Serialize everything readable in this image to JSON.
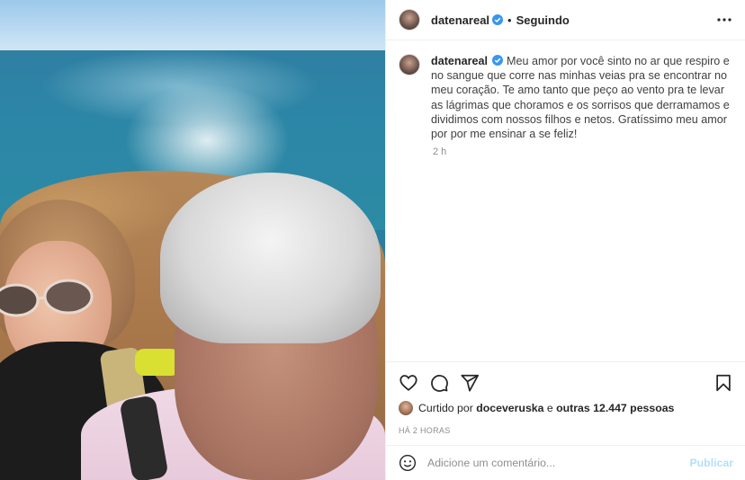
{
  "post": {
    "username": "datenareal",
    "dot": "•",
    "follow_status": "Seguindo",
    "caption": "Meu amor por você sinto no ar que respiro e no sangue que corre nas minhas veias pra se encontrar no meu coração. Te amo tanto que peço ao vento pra te levar as lágrimas que choramos e os sorrisos que derramamos e dividimos com nossos filhos e netos. Gratíssimo meu amor por por me ensinar a se feliz!",
    "time_ago": "2 h",
    "liked_prefix": "Curtido por",
    "liked_user": "doceveruska",
    "liked_middle": "e",
    "liked_others": "outras 12.447 pessoas",
    "date_label": "HÁ 2 HORAS"
  },
  "comment": {
    "placeholder": "Adicione um comentário...",
    "publish_label": "Publicar"
  },
  "icons": {
    "verified": "verified-badge-icon",
    "more": "more-options-icon",
    "like": "heart-icon",
    "comment": "comment-icon",
    "share": "share-icon",
    "save": "bookmark-icon",
    "emoji": "emoji-icon"
  },
  "colors": {
    "verified_blue": "#3897f0",
    "publish_disabled": "#b2dffc",
    "muted_text": "#8e8e8e"
  }
}
